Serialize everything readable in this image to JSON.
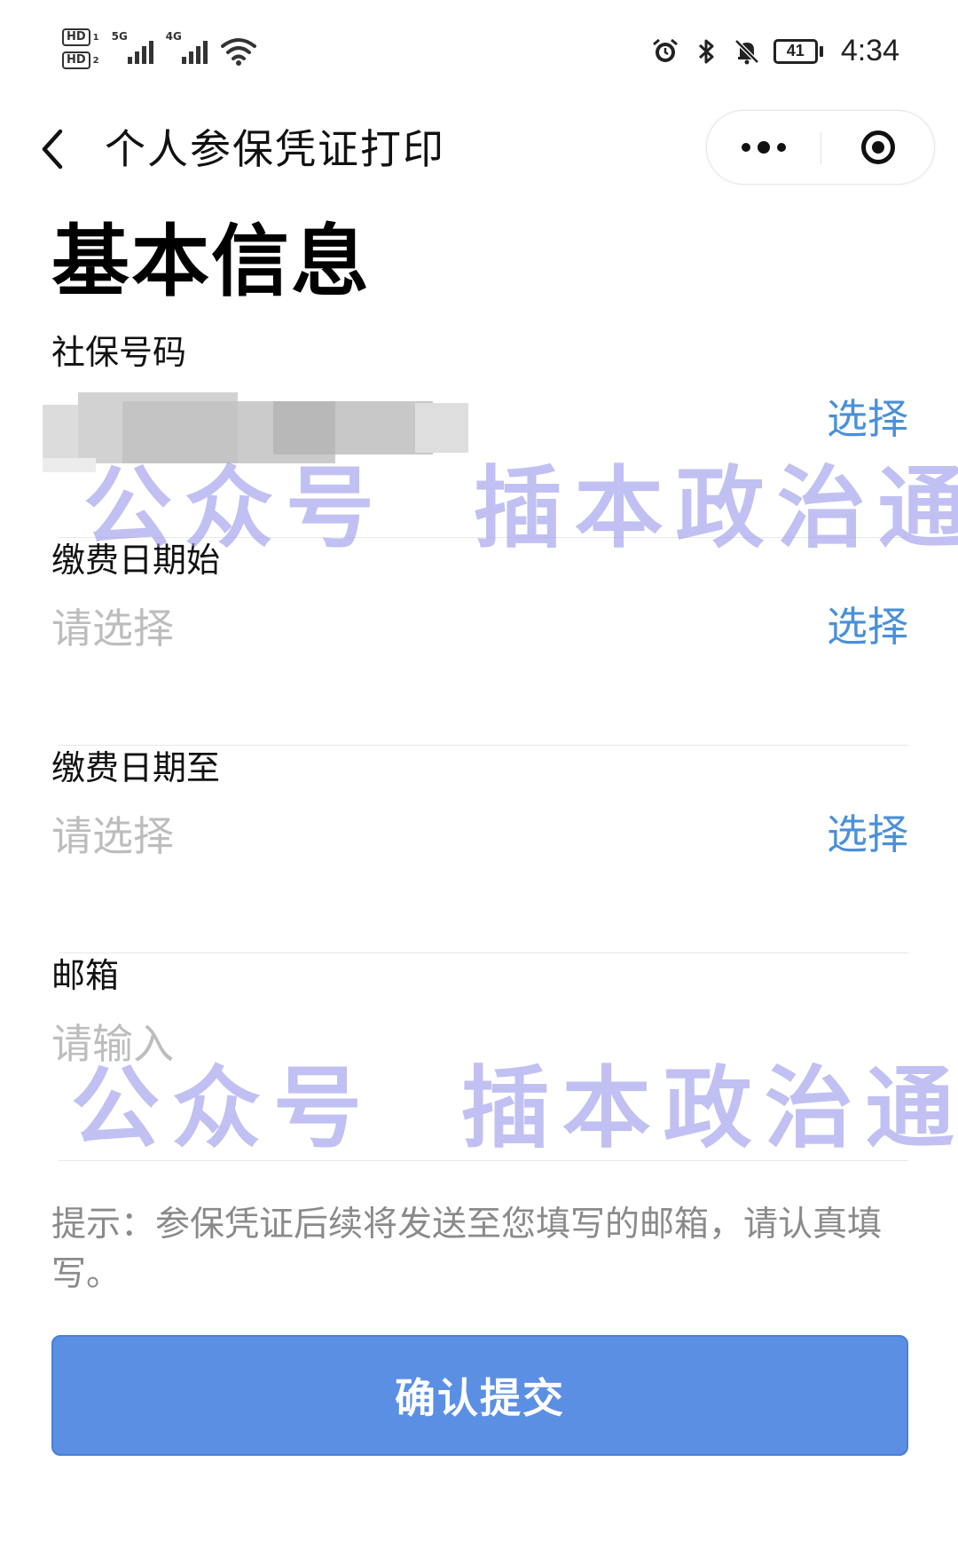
{
  "status_bar": {
    "hd_1": "HD",
    "hd_1_sub": "1",
    "hd_2": "HD",
    "hd_2_sub": "2",
    "network_1": "5G",
    "network_2": "4G",
    "battery_level": "41",
    "time": "4:34"
  },
  "nav": {
    "title": "个人参保凭证打印"
  },
  "section_title": "基本信息",
  "fields": [
    {
      "label": "社保号码",
      "value": "",
      "action": "选择"
    },
    {
      "label": "缴费日期始",
      "placeholder": "请选择",
      "action": "选择"
    },
    {
      "label": "缴费日期至",
      "placeholder": "请选择",
      "action": "选择"
    },
    {
      "label": "邮箱",
      "placeholder": "请输入"
    }
  ],
  "tip": "提示：参保凭证后续将发送至您填写的邮箱，请认真填写。",
  "submit_label": "确认提交",
  "watermark": "公众号  插本政治通",
  "colors": {
    "accent": "#4a90d9",
    "button": "#5b8fe3",
    "placeholder": "#bdbdbd",
    "tip": "#8a8a8a",
    "watermark": "#9696eb"
  }
}
